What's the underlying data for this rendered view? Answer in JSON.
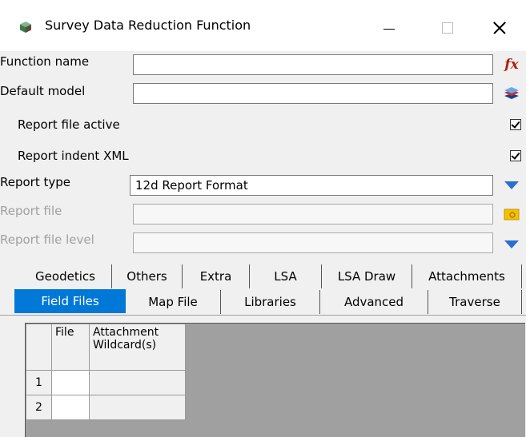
{
  "window": {
    "title": "Survey Data Reduction Function"
  },
  "form": {
    "function_name": {
      "label": "Function name",
      "value": "",
      "button_glyph": "fx",
      "button_icon": "function-fx-icon"
    },
    "default_model": {
      "label": "Default model",
      "value": "",
      "button_icon": "model-layers-icon"
    },
    "report_file_active": {
      "label": "Report file active",
      "checked": true
    },
    "report_indent_xml": {
      "label": "Report indent XML",
      "checked": true
    },
    "report_type": {
      "label": "Report type",
      "value": "12d Report Format",
      "button_icon": "dropdown-arrow-icon"
    },
    "report_file": {
      "label": "Report file",
      "value": "",
      "disabled": true,
      "button_icon": "folder-icon"
    },
    "report_file_level": {
      "label": "Report file level",
      "value": "",
      "disabled": true,
      "button_icon": "dropdown-arrow-icon"
    }
  },
  "tabs": {
    "row1": [
      "Geodetics",
      "Others",
      "Extra",
      "LSA",
      "LSA Draw",
      "Attachments"
    ],
    "row2": [
      "Field Files",
      "Map File",
      "Libraries",
      "Advanced",
      "Traverse"
    ],
    "active": "Field Files"
  },
  "table": {
    "columns": [
      "File",
      "Attachment\nWildcard(s)"
    ],
    "rows": [
      {
        "num": "1",
        "file": "",
        "wildcard": ""
      },
      {
        "num": "2",
        "file": "",
        "wildcard": ""
      }
    ]
  },
  "colors": {
    "accent": "#0078d7",
    "fx_button": "#b02010",
    "folder_button": "#f2c200"
  }
}
